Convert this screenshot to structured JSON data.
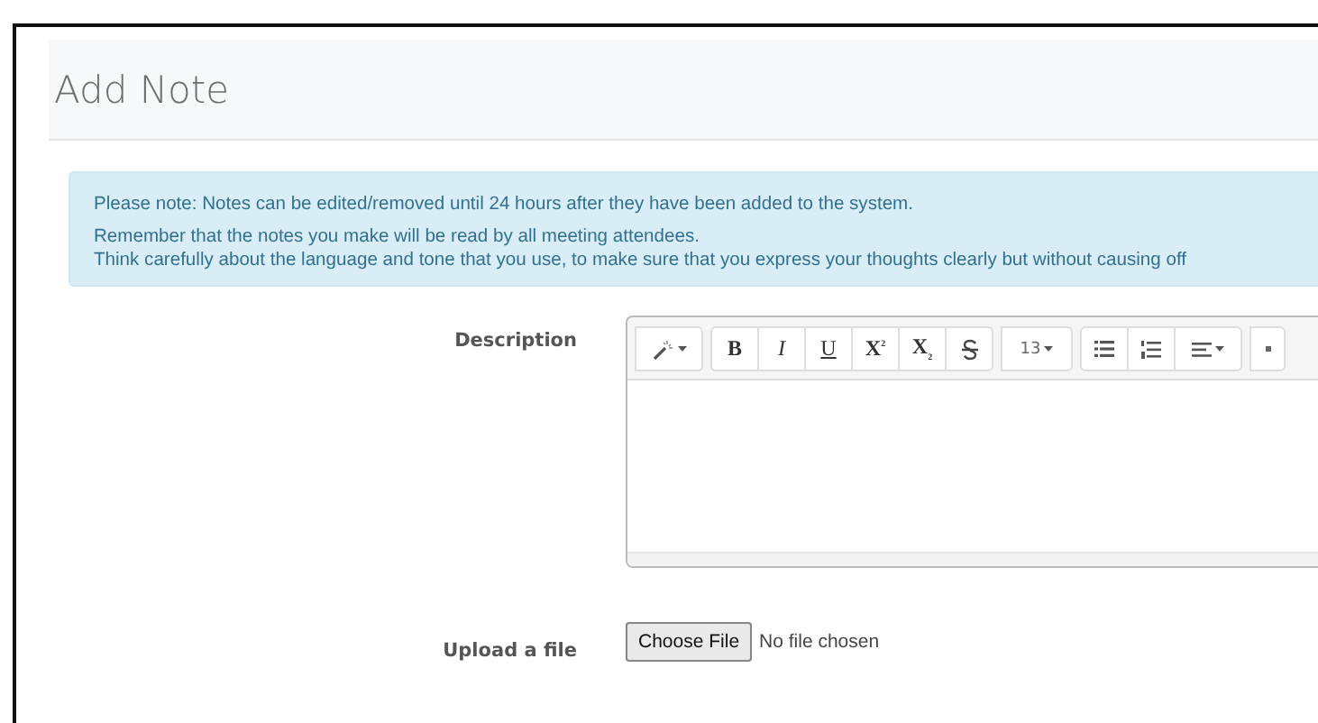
{
  "header": {
    "title": "Add Note"
  },
  "alert": {
    "lines": [
      "Please note: Notes can be edited/removed until 24 hours after they have been added to the system.",
      "Remember that the notes you make will be read by all meeting attendees.",
      "Think carefully about the language and tone that you use, to make sure that you express your thoughts clearly but without causing off"
    ]
  },
  "description": {
    "label": "Description",
    "toolbar": [
      [
        {
          "kind": "wand"
        }
      ],
      [
        {
          "kind": "bold",
          "text": "B"
        },
        {
          "kind": "italic",
          "text": "I"
        },
        {
          "kind": "underline",
          "text": "U"
        },
        {
          "kind": "plain",
          "text": "X$^{2}$"
        },
        {
          "kind": "plain",
          "text": "X$_{2}$"
        },
        {
          "kind": "strike"
        }
      ],
      [
        {
          "kind": "size",
          "text": "13"
        }
      ],
      [
        {
          "kind": "bullets"
        },
        {
          "kind": "numbers"
        },
        {
          "kind": "align"
        }
      ],
      [
        {
          "kind": "partial"
        }
      ]
    ]
  },
  "upload": {
    "label": "Upload a file",
    "button": "Choose File",
    "status": "No file chosen"
  }
}
